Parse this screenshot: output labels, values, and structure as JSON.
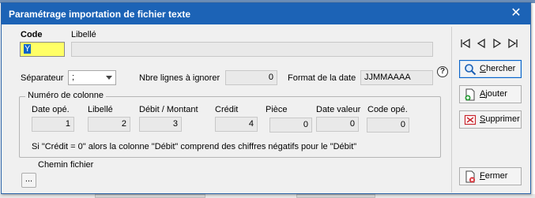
{
  "window": {
    "title": "Paramétrage importation de fichier texte",
    "close_symbol": "✕"
  },
  "header": {
    "code_label": "Code",
    "code_value": "Y",
    "libelle_label": "Libellé",
    "libelle_value": ""
  },
  "options": {
    "separateur_label": "Séparateur",
    "separateur_value": ";",
    "nbre_lignes_label": "Nbre lignes à ignorer",
    "nbre_lignes_value": "0",
    "format_date_label": "Format de la date",
    "format_date_value": "JJMMAAAA",
    "help_symbol": "?"
  },
  "columns": {
    "group_title": "Numéro de colonne",
    "items": [
      {
        "label": "Date opé.",
        "value": "1"
      },
      {
        "label": "Libellé",
        "value": "2"
      },
      {
        "label": "Débit / Montant",
        "value": "3"
      },
      {
        "label": "Crédit",
        "value": "4"
      },
      {
        "label": "Pièce",
        "value": "0"
      },
      {
        "label": "Date valeur",
        "value": "0"
      },
      {
        "label": "Code opé.",
        "value": "0"
      }
    ],
    "note": "Si \"Crédit = 0\" alors la colonne \"Débit\" comprend des chiffres négatifs pour le \"Débit\""
  },
  "file": {
    "chemin_label": "Chemin fichier",
    "browse_label": "..."
  },
  "sidebar": {
    "nav": [
      "first-icon",
      "previous-icon",
      "next-icon",
      "last-icon"
    ],
    "buttons": {
      "chercher": {
        "mnemonic": "C",
        "rest": "hercher"
      },
      "ajouter": {
        "mnemonic": "A",
        "rest": "jouter"
      },
      "supprimer": {
        "mnemonic": "S",
        "rest": "upprimer"
      },
      "fermer": {
        "mnemonic": "F",
        "rest": "ermer"
      }
    }
  },
  "colors": {
    "titlebar": "#1c63b6",
    "focus_field": "#ffff66",
    "selection": "#0a64c8"
  }
}
